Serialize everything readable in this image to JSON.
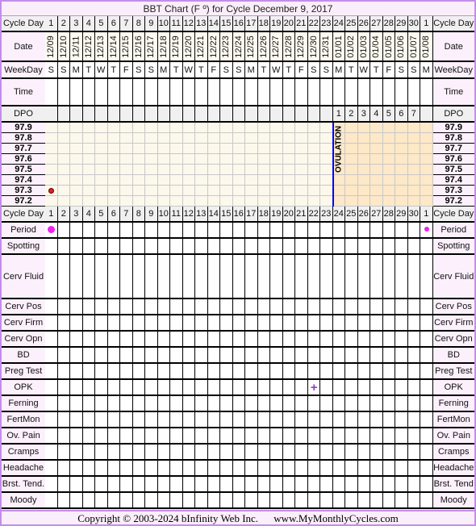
{
  "title": "BBT Chart (F º) for Cycle December 9, 2017",
  "row_labels": {
    "cycle_day": "Cycle Day",
    "date": "Date",
    "weekday": "WeekDay",
    "time": "Time",
    "dpo": "DPO",
    "period": "Period",
    "spotting": "Spotting",
    "cerv_fluid": "Cerv Fluid",
    "cerv_pos": "Cerv Pos",
    "cerv_firm": "Cerv Firm",
    "cerv_opn": "Cerv Opn",
    "bd": "BD",
    "preg_test": "Preg Test",
    "opk": "OPK",
    "ferning": "Ferning",
    "fertmon": "FertMon",
    "ov_pain": "Ov. Pain",
    "cramps": "Cramps",
    "headache": "Headache",
    "brst_tend_left": "Brst. Tend.",
    "brst_tend_right": "Brst. Tend",
    "moody": "Moody"
  },
  "chart_data": {
    "type": "line",
    "title": "BBT Chart (F º) for Cycle December 9, 2017",
    "cycle_days": [
      "1",
      "2",
      "3",
      "4",
      "5",
      "6",
      "7",
      "8",
      "9",
      "10",
      "11",
      "12",
      "13",
      "14",
      "15",
      "16",
      "17",
      "18",
      "19",
      "20",
      "21",
      "22",
      "23",
      "24",
      "25",
      "26",
      "27",
      "28",
      "29",
      "30",
      "1"
    ],
    "dates": [
      "12/09",
      "12/10",
      "12/11",
      "12/12",
      "12/13",
      "12/14",
      "12/15",
      "12/16",
      "12/17",
      "12/18",
      "12/19",
      "12/20",
      "12/21",
      "12/22",
      "12/23",
      "12/24",
      "12/25",
      "12/26",
      "12/27",
      "12/28",
      "12/29",
      "12/30",
      "12/31",
      "01/01",
      "01/02",
      "01/03",
      "01/04",
      "01/05",
      "01/06",
      "01/07",
      "01/08"
    ],
    "weekdays": [
      "S",
      "S",
      "M",
      "T",
      "W",
      "T",
      "F",
      "S",
      "S",
      "M",
      "T",
      "W",
      "T",
      "F",
      "S",
      "S",
      "M",
      "T",
      "W",
      "T",
      "F",
      "S",
      "S",
      "M",
      "T",
      "W",
      "T",
      "F",
      "S",
      "S",
      "M"
    ],
    "dpo": [
      "",
      "",
      "",
      "",
      "",
      "",
      "",
      "",
      "",
      "",
      "",
      "",
      "",
      "",
      "",
      "",
      "",
      "",
      "",
      "",
      "",
      "",
      "",
      "1",
      "2",
      "3",
      "4",
      "5",
      "6",
      "7",
      ""
    ],
    "temperature_ticks": [
      "97.9",
      "97.8",
      "97.7",
      "97.6",
      "97.5",
      "97.4",
      "97.3",
      "97.2"
    ],
    "ylim": [
      97.2,
      97.9
    ],
    "temperatures": [
      {
        "day_index": 0,
        "value": 97.3
      }
    ],
    "ovulation": {
      "after_day_index": 22,
      "label": "OVULATION",
      "line_color": "#0000ff"
    },
    "post_ovulation_shade": "#fde8c8",
    "pre_ovulation_shade": "#fcf8ec",
    "temp_point_color": "#e02020",
    "period": [
      {
        "day_index": 0,
        "size": "large"
      },
      {
        "day_index": 30,
        "size": "small"
      }
    ],
    "period_color": "#ee22ee",
    "opk": [
      {
        "day_index": 21,
        "symbol": "+"
      }
    ],
    "opk_color": "#8844cc"
  },
  "footer": {
    "copyright": "Copyright © 2003-2024 bInfinity Web Inc.",
    "site": "www.MyMonthlyCycles.com"
  }
}
